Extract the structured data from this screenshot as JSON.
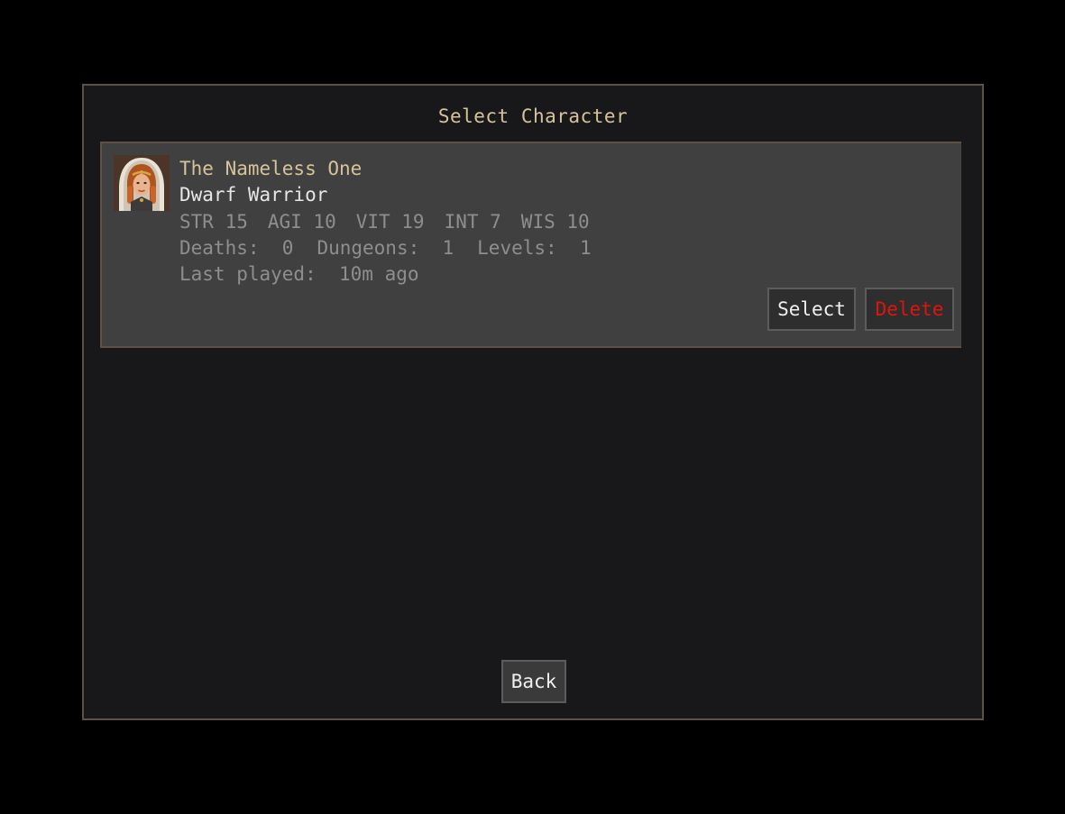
{
  "dialog": {
    "title": "Select Character"
  },
  "character": {
    "name": "The Nameless One",
    "class": "Dwarf Warrior",
    "stats": [
      {
        "label": "STR",
        "value": "15"
      },
      {
        "label": "AGI",
        "value": "10"
      },
      {
        "label": "VIT",
        "value": "19"
      },
      {
        "label": "INT",
        "value": "7"
      },
      {
        "label": "WIS",
        "value": "10"
      }
    ],
    "stats_text": [
      "STR 15",
      "AGI 10",
      "VIT 19",
      "INT 7",
      "WIS 10"
    ],
    "records_text": [
      "Deaths:  0",
      "Dungeons:  1",
      "Levels:  1"
    ],
    "last_played_text": "Last played:  10m ago",
    "portrait_icon": "hooded-woman-portrait-icon"
  },
  "buttons": {
    "select_label": "Select",
    "delete_label": "Delete",
    "back_label": "Back"
  },
  "colors": {
    "title": "#d6c39a",
    "name": "#d6c39a",
    "delete": "#e0140f",
    "border": "#5e5046"
  }
}
